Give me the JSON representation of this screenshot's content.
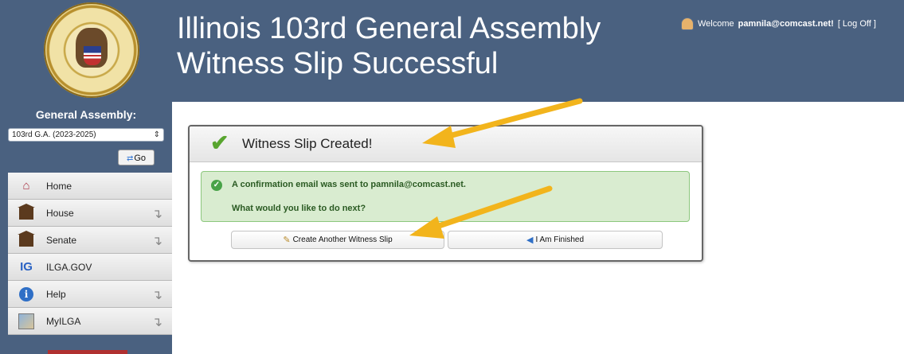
{
  "header": {
    "title_line1": "Illinois 103rd General Assembly",
    "title_line2": "Witness Slip Successful",
    "welcome_prefix": "Welcome",
    "username": "pamnila@comcast.net!",
    "logoff": "[ Log Off ]"
  },
  "sidebar": {
    "ga_label": "General Assembly:",
    "ga_selected": "103rd G.A. (2023-2025)",
    "go_label": "Go",
    "items": [
      {
        "label": "Home",
        "icon": "home-icon"
      },
      {
        "label": "House",
        "icon": "house-building-icon"
      },
      {
        "label": "Senate",
        "icon": "senate-building-icon"
      },
      {
        "label": "ILGA.GOV",
        "icon": "ilga-logo-icon"
      },
      {
        "label": "Help",
        "icon": "info-icon"
      },
      {
        "label": "MyILGA",
        "icon": "map-icon"
      }
    ]
  },
  "panel": {
    "title": "Witness Slip Created!",
    "confirmation": "A confirmation email was sent to pamnila@comcast.net.",
    "next_prompt": "What would you like to do next?",
    "create_another": "Create Another Witness Slip",
    "finished": "I Am Finished"
  },
  "colors": {
    "header_bg": "#4a6180",
    "success_green": "#58a52f",
    "notice_bg": "#d9ecd0",
    "annotation_arrow": "#f2b41c"
  }
}
